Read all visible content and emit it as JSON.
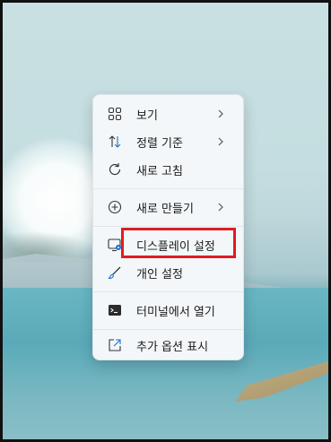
{
  "context_menu": {
    "items": [
      {
        "label": "보기",
        "icon": "grid-icon",
        "submenu": true
      },
      {
        "label": "정렬 기준",
        "icon": "sort-arrows-icon",
        "submenu": true
      },
      {
        "label": "새로 고침",
        "icon": "refresh-icon",
        "submenu": false
      },
      {
        "label": "새로 만들기",
        "icon": "plus-circle-icon",
        "submenu": true
      },
      {
        "label": "디스플레이 설정",
        "icon": "display-settings-icon",
        "submenu": false
      },
      {
        "label": "개인 설정",
        "icon": "brush-icon",
        "submenu": false
      },
      {
        "label": "터미널에서 열기",
        "icon": "terminal-icon",
        "submenu": false
      },
      {
        "label": "추가 옵션 표시",
        "icon": "open-external-icon",
        "submenu": false
      }
    ]
  },
  "highlight_color": "#e01b24"
}
